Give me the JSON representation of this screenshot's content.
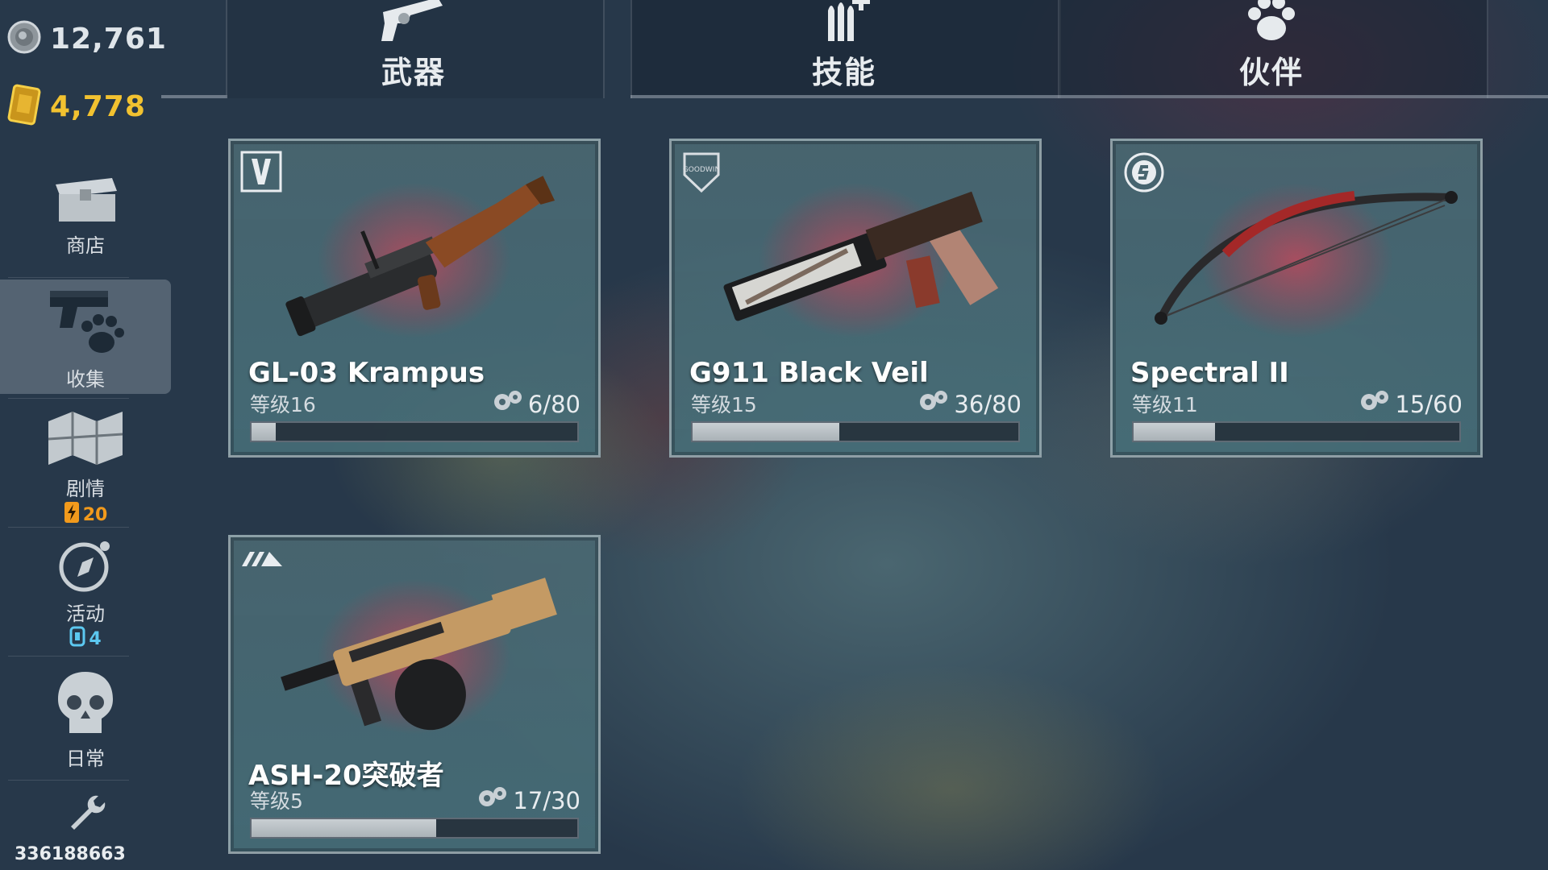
{
  "currencies": {
    "silver": {
      "value": "12,761",
      "icon": "silver-coin-icon",
      "color": "#dfe5ea"
    },
    "gold": {
      "value": "4,778",
      "icon": "gold-bar-icon",
      "color": "#f2c230"
    }
  },
  "sidebar": {
    "items": [
      {
        "label": "商店",
        "icon": "chest-icon"
      },
      {
        "label": "收集",
        "icon": "pistol-paw-icon",
        "active": true
      },
      {
        "label": "剧情",
        "icon": "map-icon",
        "badge": "20",
        "badge_icon": "energy-icon",
        "badge_color": "#f29a1c"
      },
      {
        "label": "活动",
        "icon": "compass-icon",
        "badge": "4",
        "badge_icon": "ticket-icon",
        "badge_color": "#5cc8f0"
      },
      {
        "label": "日常",
        "icon": "skull-icon"
      }
    ],
    "settings_icon": "wrench-icon",
    "user_id": "336188663"
  },
  "tabs": [
    {
      "label": "武器",
      "icon": "revolver-icon",
      "active": true
    },
    {
      "label": "技能",
      "icon": "ammo-plus-icon",
      "active": false
    },
    {
      "label": "伙伴",
      "icon": "paw-icon",
      "active": false
    }
  ],
  "cards": [
    {
      "name": "GL-03 Krampus",
      "level": "等级16",
      "parts": "6/80",
      "progress": 0.075,
      "brand_icon": "v-brand-icon",
      "weapon_icon": "grenade-launcher-icon"
    },
    {
      "name": "G911 Black Veil",
      "level": "等级15",
      "parts": "36/80",
      "progress": 0.45,
      "brand_icon": "goodwin-brand-icon",
      "brand_text": "GOODWIN",
      "weapon_icon": "pistol-icon"
    },
    {
      "name": "Spectral II",
      "level": "等级11",
      "parts": "15/60",
      "progress": 0.25,
      "brand_icon": "s-brand-icon",
      "weapon_icon": "compound-bow-icon"
    },
    {
      "name": "ASH-20突破者",
      "level": "等级5",
      "parts": "17/30",
      "progress": 0.567,
      "brand_icon": "stripes-brand-icon",
      "weapon_icon": "drum-shotgun-icon"
    }
  ],
  "parts_icon": "gears-icon"
}
